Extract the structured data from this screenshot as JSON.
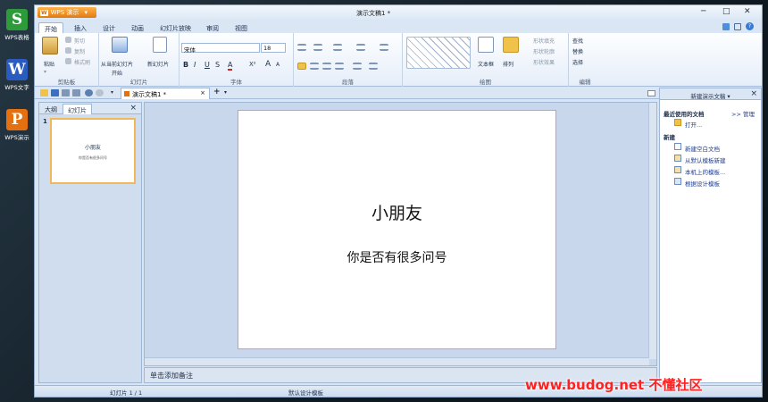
{
  "desktop": {
    "icons": [
      {
        "label": "WPS表格",
        "glyph": "S",
        "color": "#2e9b3a",
        "icon": "wps-spreadsheets-icon"
      },
      {
        "label": "WPS文字",
        "glyph": "W",
        "color": "#2a5bc0",
        "icon": "wps-writer-icon"
      },
      {
        "label": "WPS演示",
        "glyph": "P",
        "color": "#e5700f",
        "icon": "wps-presentation-icon"
      }
    ]
  },
  "window": {
    "app_button": "WPS 演示",
    "title": "演示文稿1 *",
    "controls": {
      "minimize": "─",
      "maximize": "□",
      "close": "✕"
    }
  },
  "menu_tabs": [
    "开始",
    "插入",
    "设计",
    "动画",
    "幻灯片放映",
    "审阅",
    "视图"
  ],
  "active_tab": "开始",
  "ribbon": {
    "clipboard": {
      "paste": "粘贴",
      "cut": "剪切",
      "copy": "复制",
      "format_painter": "格式刷",
      "label": "剪贴板"
    },
    "slides": {
      "from_current": "从当前幻灯片",
      "start": "开始",
      "new_slide": "新幻灯片",
      "label": "幻灯片"
    },
    "font": {
      "name": "宋体",
      "size": "18",
      "bold": "B",
      "italic": "I",
      "underline": "U",
      "shadow": "S",
      "font_color": "A",
      "superscript": "X²",
      "grow": "A",
      "shrink": "A",
      "label": "字体"
    },
    "paragraph": {
      "label": "段落"
    },
    "drawing": {
      "textbox": "文本框",
      "arrange": "排列",
      "shape_fill": "形状填充",
      "shape_outline": "形状轮廓",
      "shape_effect": "形状效果",
      "label": "绘图"
    },
    "editing": {
      "find": "查找",
      "replace": "替换",
      "select": "选择",
      "label": "编辑"
    }
  },
  "doc_tab": {
    "name": "演示文稿1 *",
    "close": "×",
    "add": "+"
  },
  "left_panel": {
    "tab_outline": "大纲",
    "tab_slides": "幻灯片",
    "close": "×",
    "slide_number": "1"
  },
  "slide": {
    "title": "小朋友",
    "subtitle": "你是否有很多问号"
  },
  "notes_placeholder": "单击添加备注",
  "task_pane": {
    "header": "新建演示文稿 ▾",
    "close": "×",
    "recent_heading": "最近使用的文档",
    "manage": ">> 管理",
    "open": "打开...",
    "new_heading": "新建",
    "items": [
      "新建空白文档",
      "从默认模板新建",
      "本机上的模板...",
      "根据设计模板"
    ]
  },
  "status_bar": {
    "slide_counter": "幻灯片 1 / 1",
    "template": "默认设计模板"
  },
  "watermark": "www.budog.net 不懂社区"
}
